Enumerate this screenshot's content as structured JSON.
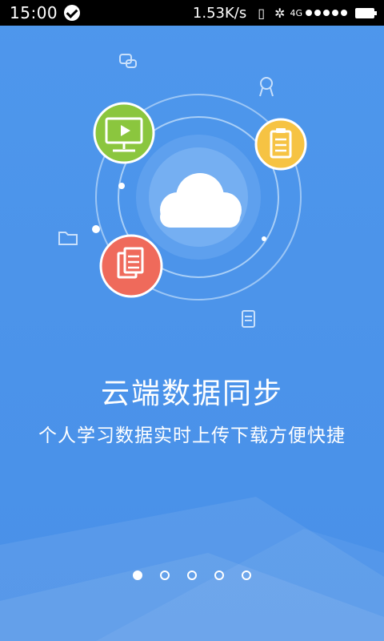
{
  "status_bar": {
    "time": "15:00",
    "speed": "1.53K/s",
    "network": "4G",
    "signal_bars": 5,
    "icons": [
      "check-circle-icon",
      "vibrate-icon",
      "flower-icon",
      "battery-icon"
    ]
  },
  "illustration": {
    "center_icon": "cloud-icon",
    "orbit_icons": [
      "video-monitor-icon",
      "clipboard-icon",
      "document-icon"
    ],
    "floating_icons": [
      "chat-bubbles-icon",
      "award-ribbon-icon",
      "folder-icon",
      "small-clipboard-icon"
    ],
    "colors": {
      "green": "#8bc63e",
      "yellow": "#f6c343",
      "red": "#ef6a5b",
      "background": "#4a93ea"
    }
  },
  "content": {
    "headline": "云端数据同步",
    "subline": "个人学习数据实时上传下载方便快捷"
  },
  "pager": {
    "count": 5,
    "active_index": 0
  }
}
